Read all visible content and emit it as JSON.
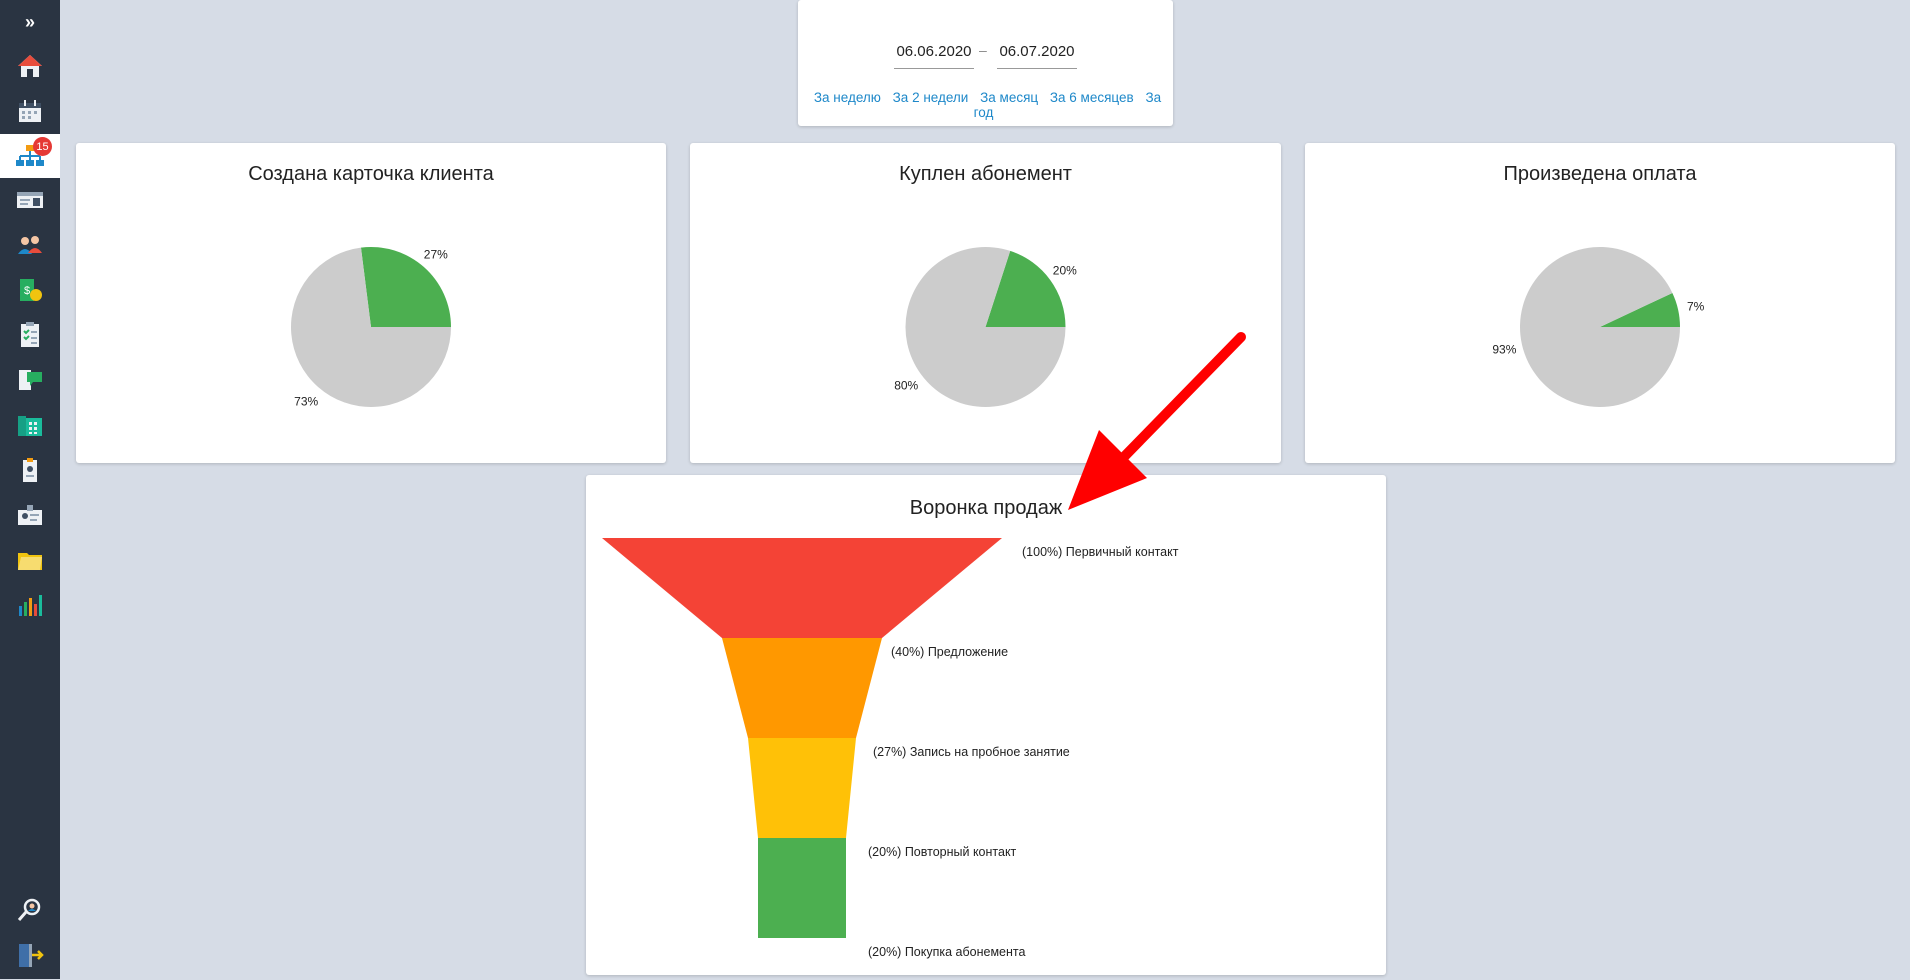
{
  "sidebar": {
    "toggle_label": "»",
    "badge": "15",
    "icons": [
      "home-icon",
      "calendar-icon",
      "org-chart-icon",
      "id-card-icon",
      "users-icon",
      "money-icon",
      "checklist-icon",
      "chat-icon",
      "phone-book-icon",
      "badge-icon",
      "employee-card-icon",
      "folder-icon",
      "bar-chart-icon",
      "search-user-icon",
      "logout-icon"
    ]
  },
  "date_range": {
    "from": "06.06.2020",
    "separator": "–",
    "to": "06.07.2020",
    "periods": [
      "За неделю",
      "За 2 недели",
      "За месяц",
      "За 6 месяцев",
      "За год"
    ]
  },
  "colors": {
    "green": "#4caf50",
    "gray": "#cccccc",
    "red": "#f44336",
    "orange": "#ff9800",
    "amber": "#ffc107",
    "link": "#1e88c9",
    "annotation_arrow": "#ff0000"
  },
  "chart_data": [
    {
      "type": "pie",
      "title": "Создана карточка клиента",
      "slices": [
        {
          "label": "27%",
          "value": 27,
          "color": "#4caf50"
        },
        {
          "label": "73%",
          "value": 73,
          "color": "#cccccc"
        }
      ]
    },
    {
      "type": "pie",
      "title": "Куплен абонемент",
      "slices": [
        {
          "label": "20%",
          "value": 20,
          "color": "#4caf50"
        },
        {
          "label": "80%",
          "value": 80,
          "color": "#cccccc"
        }
      ]
    },
    {
      "type": "pie",
      "title": "Произведена оплата",
      "slices": [
        {
          "label": "7%",
          "value": 7,
          "color": "#4caf50"
        },
        {
          "label": "93%",
          "value": 93,
          "color": "#cccccc"
        }
      ]
    },
    {
      "type": "funnel",
      "title": "Воронка продаж",
      "stages": [
        {
          "label": "(100%) Первичный контакт",
          "value": 100,
          "color": "#f44336"
        },
        {
          "label": "(40%) Предложение",
          "value": 40,
          "color": "#ff9800"
        },
        {
          "label": "(27%) Запись на пробное занятие",
          "value": 27,
          "color": "#ffc107"
        },
        {
          "label": "(20%) Повторный контакт",
          "value": 20,
          "color": "#4caf50"
        },
        {
          "label": "(20%) Покупка абонемента",
          "value": 20,
          "color": "#4caf50"
        }
      ]
    }
  ]
}
